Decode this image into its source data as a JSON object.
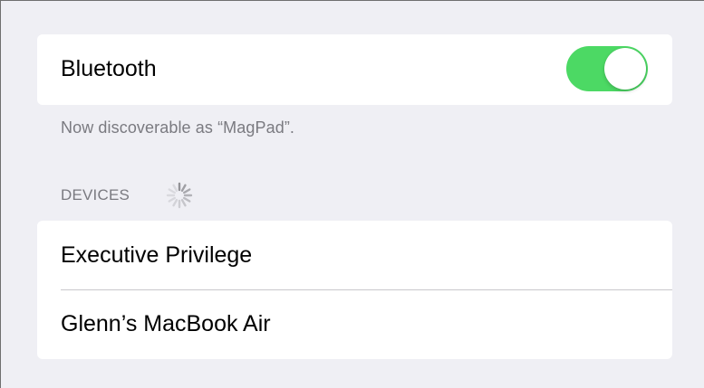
{
  "bluetooth": {
    "label": "Bluetooth",
    "enabled": true,
    "toggle_on_color": "#4cd964",
    "discoverable_text": "Now discoverable as “MagPad”."
  },
  "devices": {
    "header": "DEVICES",
    "searching_indicator": "spinner-icon",
    "items": [
      {
        "name": "Executive Privilege"
      },
      {
        "name": "Glenn’s MacBook Air"
      }
    ]
  }
}
